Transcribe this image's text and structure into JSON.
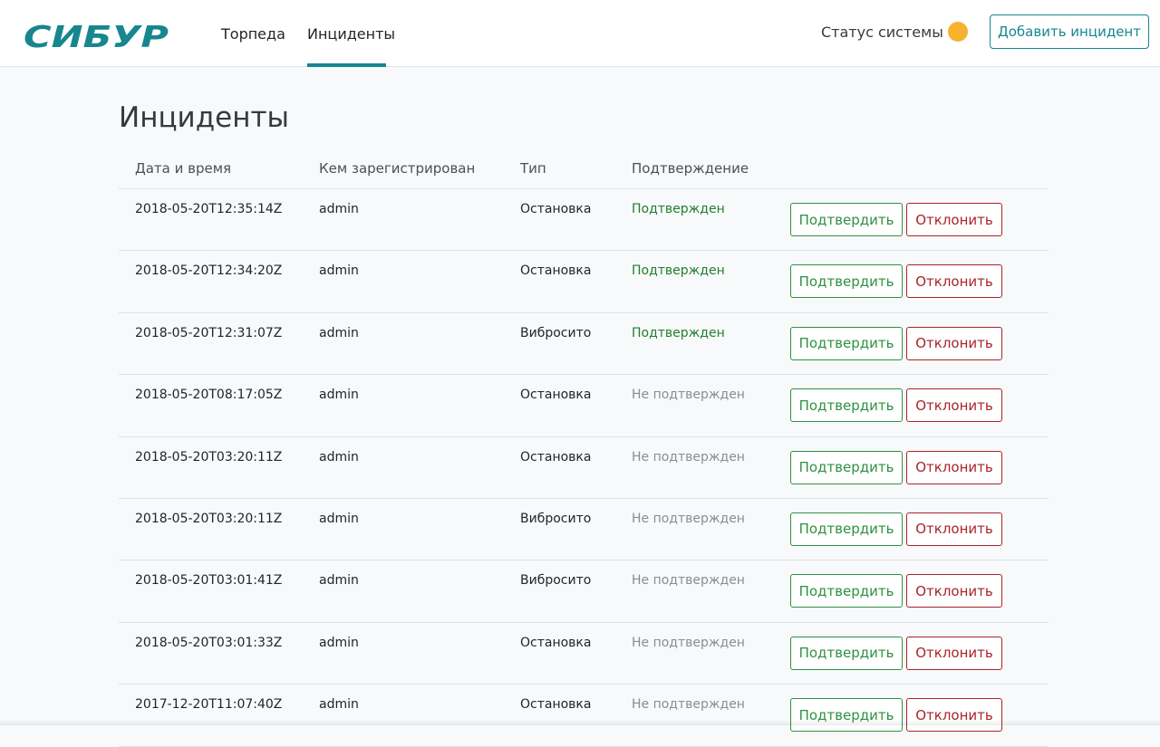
{
  "header": {
    "logo_text": "СИБУР",
    "brand_color": "#17868e",
    "nav": [
      {
        "label": "Торпеда",
        "active": false
      },
      {
        "label": "Инциденты",
        "active": true
      }
    ],
    "status_label": "Статус системы",
    "status_color": "#f6b12e",
    "add_button_label": "Добавить инцидент"
  },
  "main": {
    "title": "Инциденты",
    "columns": [
      "Дата и время",
      "Кем зарегистрирован",
      "Тип",
      "Подтверждение"
    ],
    "confirm_label": "Подтвердить",
    "reject_label": "Отклонить",
    "rows": [
      {
        "datetime": "2018-05-20T12:35:14Z",
        "user": "admin",
        "type": "Остановка",
        "confirmation": "Подтвержден",
        "confirmed": true
      },
      {
        "datetime": "2018-05-20T12:34:20Z",
        "user": "admin",
        "type": "Остановка",
        "confirmation": "Подтвержден",
        "confirmed": true
      },
      {
        "datetime": "2018-05-20T12:31:07Z",
        "user": "admin",
        "type": "Вибросито",
        "confirmation": "Подтвержден",
        "confirmed": true
      },
      {
        "datetime": "2018-05-20T08:17:05Z",
        "user": "admin",
        "type": "Остановка",
        "confirmation": "Не подтвержден",
        "confirmed": false
      },
      {
        "datetime": "2018-05-20T03:20:11Z",
        "user": "admin",
        "type": "Остановка",
        "confirmation": "Не подтвержден",
        "confirmed": false
      },
      {
        "datetime": "2018-05-20T03:20:11Z",
        "user": "admin",
        "type": "Вибросито",
        "confirmation": "Не подтвержден",
        "confirmed": false
      },
      {
        "datetime": "2018-05-20T03:01:41Z",
        "user": "admin",
        "type": "Вибросито",
        "confirmation": "Не подтвержден",
        "confirmed": false
      },
      {
        "datetime": "2018-05-20T03:01:33Z",
        "user": "admin",
        "type": "Остановка",
        "confirmation": "Не подтвержден",
        "confirmed": false
      },
      {
        "datetime": "2017-12-20T11:07:40Z",
        "user": "admin",
        "type": "Остановка",
        "confirmation": "Не подтвержден",
        "confirmed": false
      }
    ]
  }
}
